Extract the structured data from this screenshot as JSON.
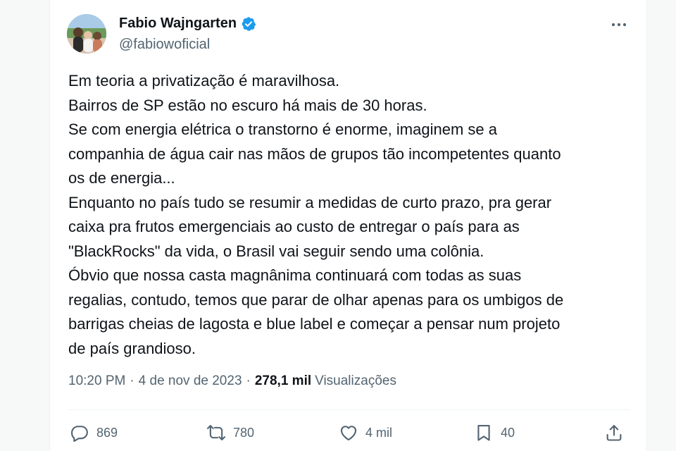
{
  "author": {
    "display_name": "Fabio Wajngarten",
    "handle": "@fabiowoficial",
    "verified": true,
    "avatar": "avatar-photo",
    "verified_color": "#1d9bf0"
  },
  "tweet": {
    "lines": [
      "Em teoria a privatização é maravilhosa.",
      "Bairros de SP estão no escuro há mais de 30 horas.",
      "Se com energia elétrica o transtorno é enorme, imaginem se a",
      "companhia de água cair nas mãos de grupos tão incompetentes quanto",
      "os de energia...",
      "Enquanto no país tudo se resumir a medidas de curto prazo, pra gerar",
      "caixa pra frutos emergenciais ao custo de entregar o país para as",
      "\"BlackRocks\" da vida, o Brasil vai seguir sendo uma colônia.",
      "Óbvio que nossa casta magnânima continuará com todas as suas",
      "regalias, contudo, temos que parar de olhar apenas para os umbigos de",
      "barrigas cheias de lagosta e blue label e começar a pensar num projeto",
      "de país grandioso."
    ]
  },
  "meta": {
    "time": "10:20 PM",
    "separator": "·",
    "date": "4 de nov de 2023",
    "views_count": "278,1 mil",
    "views_label": "Visualizações"
  },
  "actions": {
    "reply": {
      "icon": "reply-icon",
      "count": "869"
    },
    "retweet": {
      "icon": "retweet-icon",
      "count": "780"
    },
    "like": {
      "icon": "heart-icon",
      "count": "4 mil"
    },
    "bookmark": {
      "icon": "bookmark-icon",
      "count": "40"
    },
    "share": {
      "icon": "share-icon"
    }
  },
  "colors": {
    "text": "#0f1419",
    "secondary": "#536471",
    "accent": "#1d9bf0"
  }
}
